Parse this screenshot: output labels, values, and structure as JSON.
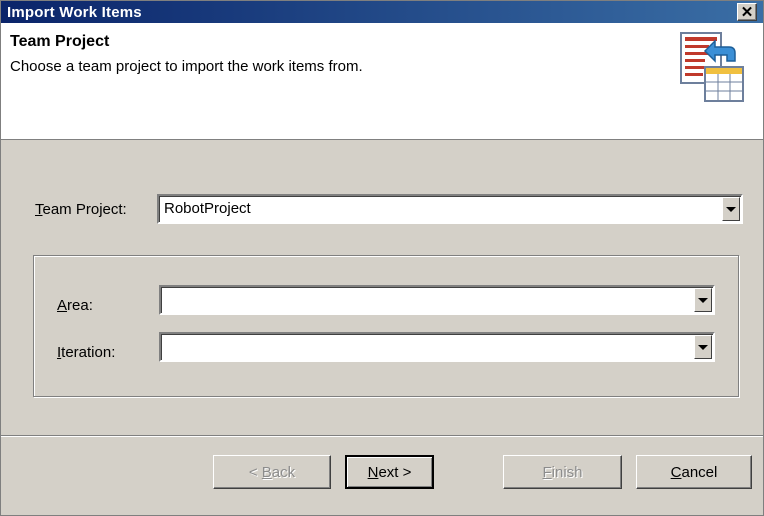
{
  "window": {
    "title": "Import Work Items",
    "close_glyph": "✕"
  },
  "header": {
    "title": "Team Project",
    "subtitle": "Choose a team project to import the work items from.",
    "icon": "import-work-items-icon"
  },
  "form": {
    "team_project": {
      "label_mnemonic": "T",
      "label_rest": "eam Project:",
      "value": "RobotProject"
    },
    "area": {
      "label_mnemonic": "A",
      "label_rest": "rea:",
      "value": ""
    },
    "iteration": {
      "label_mnemonic": "I",
      "label_rest": "teration:",
      "value": ""
    }
  },
  "buttons": {
    "back": {
      "prefix": "< ",
      "mnemonic": "B",
      "rest": "ack",
      "enabled": false
    },
    "next": {
      "mnemonic": "N",
      "rest": "ext >",
      "enabled": true
    },
    "finish": {
      "mnemonic": "F",
      "rest": "inish",
      "enabled": false
    },
    "cancel": {
      "mnemonic": "C",
      "rest": "ancel",
      "enabled": true
    }
  },
  "colors": {
    "title_bar": "#0a246a",
    "dialog_face": "#d4d0c8",
    "header_bg": "#ffffff"
  }
}
